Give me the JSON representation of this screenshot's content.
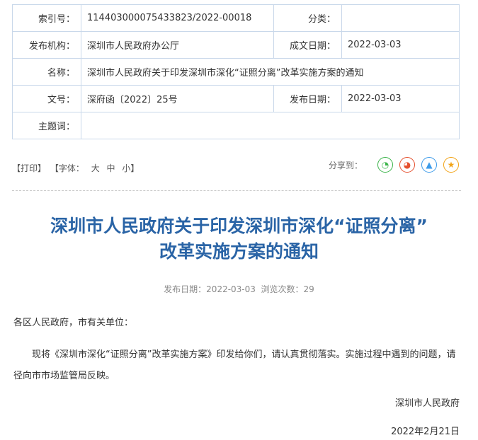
{
  "meta": {
    "index_label": "索引号：",
    "index_value": "11440300007543382​3/2022-00018",
    "category_label": "分类：",
    "category_value": "",
    "issuer_label": "发布机构：",
    "issuer_value": "深圳市人民政府办公厅",
    "created_label": "成文日期：",
    "created_value": "2022-03-03",
    "name_label": "名称：",
    "name_value": "深圳市人民政府关于印发深圳市深化“证照分离”改革实施方案的通知",
    "docno_label": "文号：",
    "docno_value": "深府函〔2022〕25号",
    "published_label": "发布日期：",
    "published_value": "2022-03-03",
    "keywords_label": "主题词：",
    "keywords_value": ""
  },
  "toolbar": {
    "print": "【打印】",
    "font_label": "【字体：",
    "font_large": "大",
    "font_medium": "中",
    "font_small": "小】",
    "share_label": "分享到：",
    "share_icons": [
      {
        "name": "wechat-icon",
        "glyph": "◔",
        "color": "#3bb44a"
      },
      {
        "name": "weibo-icon",
        "glyph": "◕",
        "color": "#e5502e"
      },
      {
        "name": "qq-icon",
        "glyph": "▲",
        "color": "#3d9be9"
      },
      {
        "name": "qzone-icon",
        "glyph": "★",
        "color": "#f2a417"
      }
    ]
  },
  "article": {
    "title_line1": "深圳市人民政府关于印发深圳市深化“证照分离”",
    "title_line2": "改革实施方案的通知",
    "publish_info": "发布日期：2022-03-03  浏览次数：29",
    "salutation": "各区人民政府，市有关单位：",
    "body": "现将《深圳市深化“证照分离”改革实施方案》印发给你们，请认真贯彻落实。实施过程中遇到的问题，请径向市市场监管局反映。",
    "signature": "深圳市人民政府",
    "date": "2022年2月21日"
  }
}
